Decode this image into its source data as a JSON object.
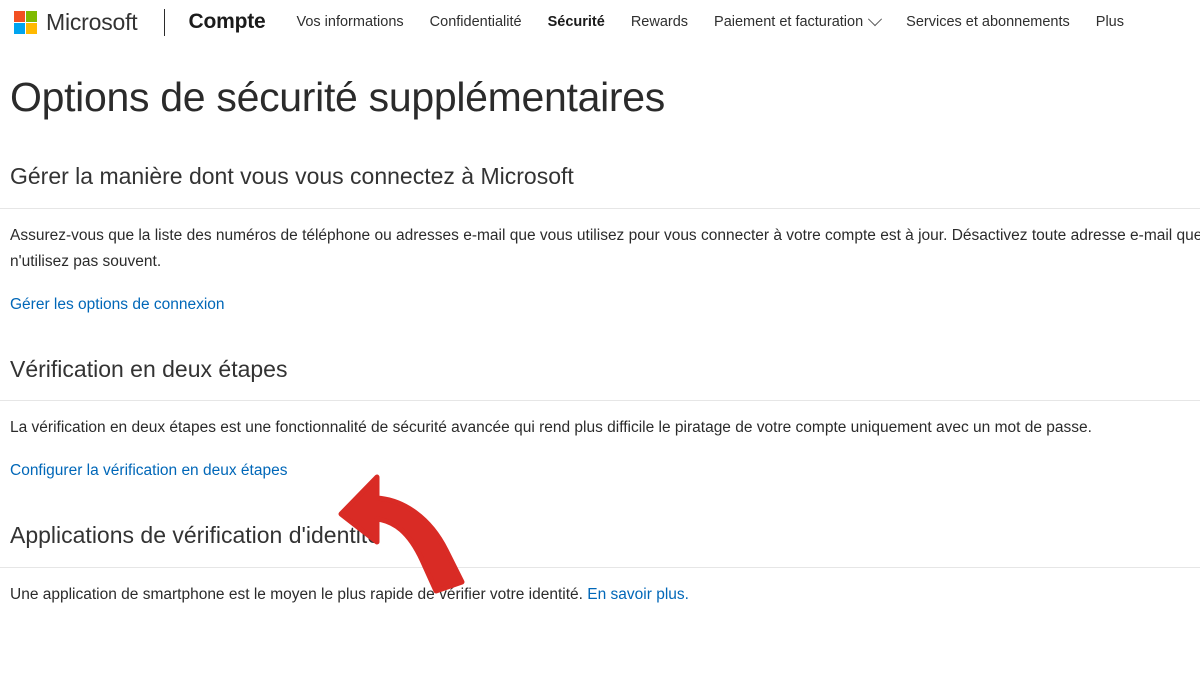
{
  "brand": {
    "logo_icon": "microsoft-logo-icon",
    "wordmark": "Microsoft",
    "product": "Compte",
    "logo_colors": {
      "top_left": "#f25022",
      "top_right": "#7fba00",
      "bottom_left": "#00a4ef",
      "bottom_right": "#ffb900"
    }
  },
  "nav": {
    "items": [
      {
        "label": "Vos informations",
        "active": false,
        "has_chevron": false
      },
      {
        "label": "Confidentialité",
        "active": false,
        "has_chevron": false
      },
      {
        "label": "Sécurité",
        "active": true,
        "has_chevron": false
      },
      {
        "label": "Rewards",
        "active": false,
        "has_chevron": false
      },
      {
        "label": "Paiement et facturation",
        "active": false,
        "has_chevron": true
      },
      {
        "label": "Services et abonnements",
        "active": false,
        "has_chevron": false
      },
      {
        "label": "Plus",
        "active": false,
        "has_chevron": false
      }
    ],
    "chevron_icon": "chevron-down-icon"
  },
  "page": {
    "title": "Options de sécurité supplémentaires"
  },
  "sections": {
    "signin": {
      "heading": "Gérer la manière dont vous vous connectez à Microsoft",
      "body": "Assurez-vous que la liste des numéros de téléphone ou adresses e-mail que vous utilisez pour vous connecter à votre compte est à jour. Désactivez toute adresse e-mail que vous n'utilisez pas souvent.",
      "link": "Gérer les options de connexion"
    },
    "two_step": {
      "heading": "Vérification en deux étapes",
      "body": "La vérification en deux étapes est une fonctionnalité de sécurité avancée qui rend plus difficile le piratage de votre compte uniquement avec un mot de passe.",
      "link": "Configurer la vérification en deux étapes"
    },
    "identity_apps": {
      "heading": "Applications de vérification d'identité",
      "body": "Une application de smartphone est le moyen le plus rapide de vérifier votre identité. ",
      "link": "En savoir plus."
    }
  },
  "annotation": {
    "arrow_icon": "curved-arrow-left-icon",
    "color": "#d92b25",
    "points_to": "Configurer la vérification en deux étapes"
  },
  "theme": {
    "link_color": "#0067b8",
    "text_color": "#2b2b2b",
    "divider_color": "#e6e6e6",
    "background": "#ffffff"
  }
}
